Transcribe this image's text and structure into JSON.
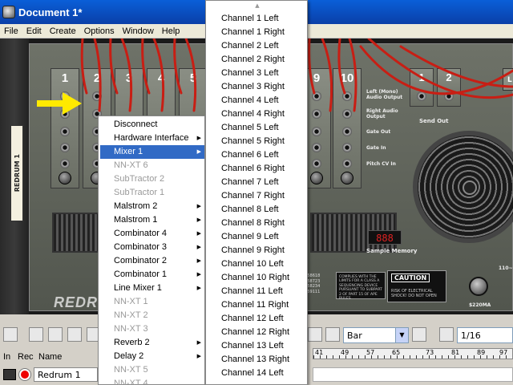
{
  "window": {
    "title": "Document 1*"
  },
  "menubar": {
    "items": [
      "File",
      "Edit",
      "Create",
      "Options",
      "Window",
      "Help"
    ]
  },
  "rack": {
    "device_tab_label": "REDRUM 1",
    "channel_numbers": [
      "1",
      "2",
      "3",
      "4",
      "5",
      "9",
      "10"
    ],
    "labels": {
      "left_out": "Left (Mono) Audio Output",
      "right_out": "Right Audio Output",
      "gate_out": "Gate Out",
      "gate_in": "Gate In",
      "pitch_cv": "Pitch CV In",
      "send_out": "Send Out",
      "send_num_1": "1",
      "send_num_2": "2",
      "sample_memory": "Sample Memory",
      "sample_memory_value": "888",
      "caution": "CAUTION",
      "caution_text": "RISK OF ELECTRICAL SHOCK! DO NOT OPEN",
      "compliance_text": "COMPLIES WITH THE LIMITS FOR A CLASS A SEQUENCING DEVICE PURSUANT TO SUBPART 2 OF PART 15 OF APE RULES",
      "serial_text": "1258618 1258723 1258234 1259111",
      "voltage_top": "110~",
      "voltage_bottom": "$220MA",
      "brand": "REDRUM",
      "right_edge": "L"
    }
  },
  "sequencer": {
    "snap_value": "Bar",
    "quantize_value": "1/16",
    "columns": {
      "in": "In",
      "rec": "Rec",
      "name": "Name"
    },
    "track_name": "Redrum 1",
    "ruler_numbers": [
      "41",
      "49",
      "57",
      "65",
      "73",
      "81",
      "89",
      "97"
    ]
  },
  "context_menu": {
    "items": [
      {
        "label": "Disconnect",
        "disabled": false,
        "submenu": false,
        "selected": false
      },
      {
        "label": "Hardware Interface",
        "disabled": false,
        "submenu": true,
        "selected": false
      },
      {
        "label": "Mixer 1",
        "disabled": false,
        "submenu": true,
        "selected": true
      },
      {
        "label": "NN-XT 6",
        "disabled": true,
        "submenu": false,
        "selected": false
      },
      {
        "label": "SubTractor 2",
        "disabled": true,
        "submenu": false,
        "selected": false
      },
      {
        "label": "SubTractor 1",
        "disabled": true,
        "submenu": false,
        "selected": false
      },
      {
        "label": "Malstrom 2",
        "disabled": false,
        "submenu": true,
        "selected": false
      },
      {
        "label": "Malstrom 1",
        "disabled": false,
        "submenu": true,
        "selected": false
      },
      {
        "label": "Combinator 4",
        "disabled": false,
        "submenu": true,
        "selected": false
      },
      {
        "label": "Combinator 3",
        "disabled": false,
        "submenu": true,
        "selected": false
      },
      {
        "label": "Combinator 2",
        "disabled": false,
        "submenu": true,
        "selected": false
      },
      {
        "label": "Combinator 1",
        "disabled": false,
        "submenu": true,
        "selected": false
      },
      {
        "label": "Line Mixer 1",
        "disabled": false,
        "submenu": true,
        "selected": false
      },
      {
        "label": "NN-XT 1",
        "disabled": true,
        "submenu": false,
        "selected": false
      },
      {
        "label": "NN-XT 2",
        "disabled": true,
        "submenu": false,
        "selected": false
      },
      {
        "label": "NN-XT 3",
        "disabled": true,
        "submenu": false,
        "selected": false
      },
      {
        "label": "Reverb 2",
        "disabled": false,
        "submenu": true,
        "selected": false
      },
      {
        "label": "Delay 2",
        "disabled": false,
        "submenu": true,
        "selected": false
      },
      {
        "label": "NN-XT 5",
        "disabled": true,
        "submenu": false,
        "selected": false
      },
      {
        "label": "NN-XT 4",
        "disabled": true,
        "submenu": false,
        "selected": false
      }
    ]
  },
  "submenu": {
    "scroll_arrow": "▲",
    "items": [
      "Channel 1 Left",
      "Channel 1 Right",
      "Channel 2 Left",
      "Channel 2 Right",
      "Channel 3 Left",
      "Channel 3 Right",
      "Channel 4 Left",
      "Channel 4 Right",
      "Channel 5 Left",
      "Channel 5 Right",
      "Channel 6 Left",
      "Channel 6 Right",
      "Channel 7 Left",
      "Channel 7 Right",
      "Channel 8 Left",
      "Channel 8 Right",
      "Channel 9 Left",
      "Channel 9 Right",
      "Channel 10 Left",
      "Channel 10 Right",
      "Channel 11 Left",
      "Channel 11 Right",
      "Channel 12 Left",
      "Channel 12 Right",
      "Channel 13 Left",
      "Channel 13 Right",
      "Channel 14 Left"
    ]
  },
  "colors": {
    "titlebar": "#0a4fc8",
    "menu_selection": "#316ac5",
    "cable_red": "#c81e14",
    "arrow_yellow": "#ffea00"
  },
  "icons": {
    "app": "reason-app-icon",
    "arrow": "yellow-arrow-icon",
    "submenu": "chevron-right-icon"
  }
}
